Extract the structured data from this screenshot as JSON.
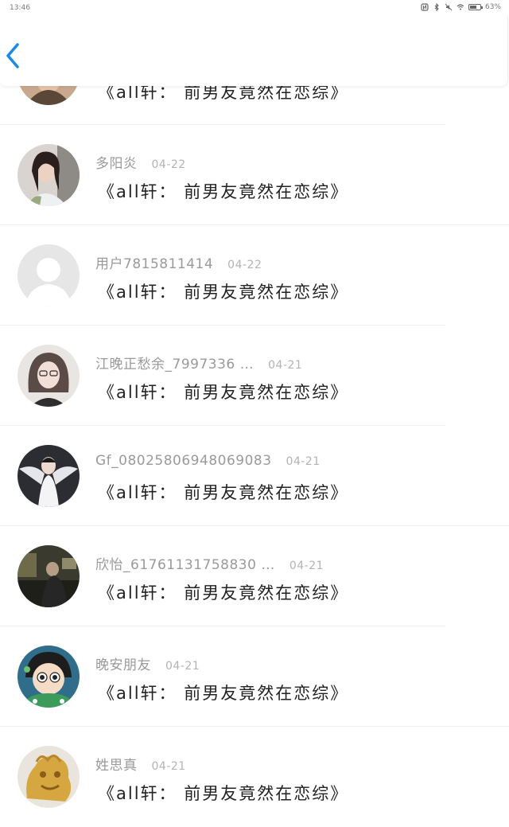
{
  "status_bar": {
    "time": "13:46",
    "battery": "63%",
    "battery_level": 0.63,
    "icons": [
      "nfc-icon",
      "bluetooth-icon",
      "mute-icon",
      "wifi-icon",
      "battery-icon"
    ]
  },
  "header": {
    "back_icon": "chevron-left-icon",
    "accent_color": "#1a8ae8"
  },
  "comments": [
    {
      "name": "",
      "date": "",
      "text": "《all轩：  前男友竟然在恋综》"
    },
    {
      "name": "多阳炎",
      "date": "04-22",
      "text": "《all轩：  前男友竟然在恋综》"
    },
    {
      "name": "用户7815811414",
      "date": "04-22",
      "text": "《all轩：  前男友竟然在恋综》"
    },
    {
      "name": "江晚正愁余_7997336 …",
      "date": "04-21",
      "text": "《all轩：  前男友竟然在恋综》"
    },
    {
      "name": "Gf_08025806948069083",
      "date": "04-21",
      "text": "《all轩：  前男友竟然在恋综》"
    },
    {
      "name": "欣怡_61761131758830 …",
      "date": "04-21",
      "text": "《all轩：  前男友竟然在恋综》"
    },
    {
      "name": "晚安朋友",
      "date": "04-21",
      "text": "《all轩：  前男友竟然在恋综》"
    },
    {
      "name": "姓思真",
      "date": "04-21",
      "text": "《all轩：  前男友竟然在恋综》"
    }
  ]
}
